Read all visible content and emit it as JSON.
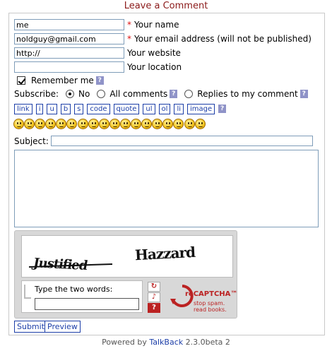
{
  "title": "Leave a Comment",
  "fields": {
    "name": {
      "value": "me",
      "label": "Your name",
      "required": "*"
    },
    "email": {
      "value": "noldguy@gmail.com",
      "label": "Your email address (will not be published)",
      "required": "*"
    },
    "website": {
      "value": "http://",
      "label": "Your website"
    },
    "location": {
      "value": "",
      "label": "Your location"
    }
  },
  "remember": {
    "label": "Remember me",
    "checked": true
  },
  "subscribe": {
    "label": "Subscribe:",
    "options": [
      {
        "label": "No",
        "selected": true
      },
      {
        "label": "All comments",
        "selected": false
      },
      {
        "label": "Replies to my comment",
        "selected": false
      }
    ]
  },
  "help_icon": "?",
  "toolbar": [
    "link",
    "i",
    "u",
    "b",
    "s",
    "code",
    "quote",
    "ul",
    "ol",
    "li",
    "image"
  ],
  "smileys": [
    "smile",
    "sad",
    "surprised",
    "grin",
    "teeth",
    "wink",
    "confused",
    "angry",
    "cool",
    "tongue",
    "neutral",
    "laugh",
    "twisted",
    "shocked",
    "cry",
    "eek",
    "rolleyes",
    "evil"
  ],
  "subject": {
    "label": "Subject:",
    "value": ""
  },
  "comment_text": "",
  "captcha": {
    "word1": "Justified",
    "word2": "Hazzard",
    "prompt": "Type the two words:",
    "brand": "reCAPTCHA™",
    "tagline_1": "stop spam.",
    "tagline_2": "read books.",
    "refresh_icon": "refresh-icon",
    "audio_icon": "audio-icon",
    "help_icon": "help-icon"
  },
  "buttons": {
    "submit": "Submit",
    "preview": "Preview"
  },
  "footer": {
    "prefix": "Powered by",
    "link": "TalkBack",
    "suffix": "2.3.0beta 2"
  },
  "colors": {
    "title": "#8b1a1a",
    "link": "#1c3ea8",
    "help_bg": "#8f93c8",
    "required": "#dd1111"
  }
}
